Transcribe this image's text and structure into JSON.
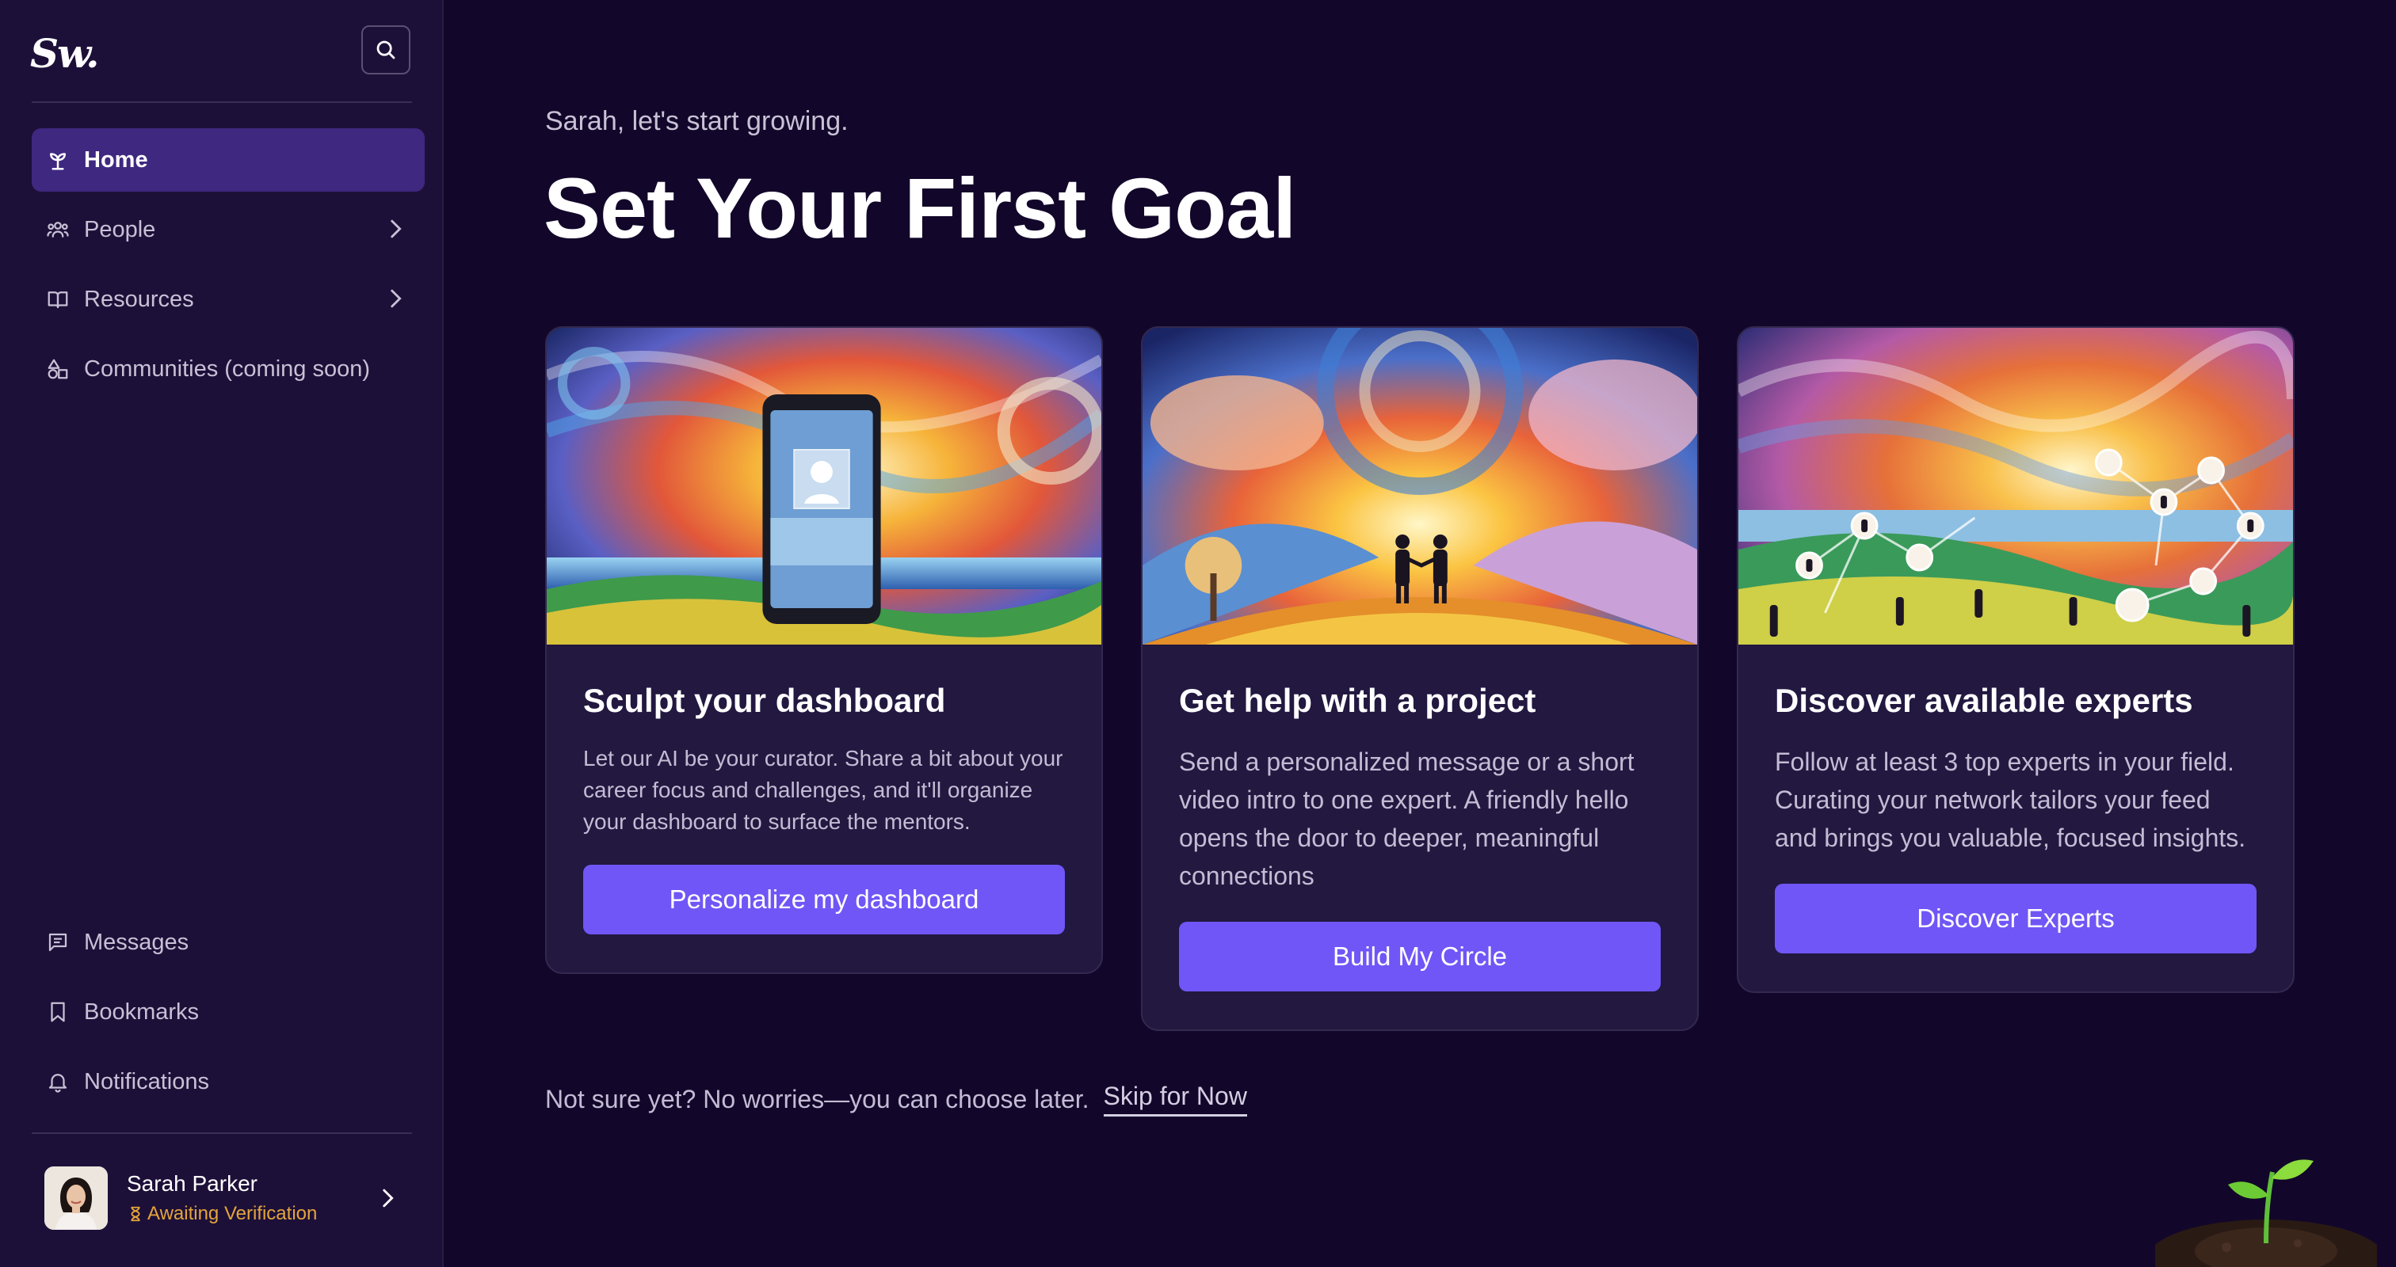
{
  "brand": {
    "logo_text": "Sw."
  },
  "sidebar": {
    "search_icon": "search-icon",
    "nav_top": [
      {
        "label": "Home",
        "icon": "sprout-icon",
        "active": true,
        "has_chevron": false
      },
      {
        "label": "People",
        "icon": "people-icon",
        "active": false,
        "has_chevron": true
      },
      {
        "label": "Resources",
        "icon": "book-icon",
        "active": false,
        "has_chevron": true
      },
      {
        "label": "Communities (coming soon)",
        "icon": "shapes-icon",
        "active": false,
        "has_chevron": false
      }
    ],
    "nav_bottom": [
      {
        "label": "Messages",
        "icon": "message-icon"
      },
      {
        "label": "Bookmarks",
        "icon": "bookmark-icon"
      },
      {
        "label": "Notifications",
        "icon": "bell-icon"
      }
    ],
    "profile": {
      "name": "Sarah Parker",
      "status": "Awaiting Verification",
      "status_color": "#e3a53c"
    }
  },
  "main": {
    "greeting": "Sarah, let's start growing.",
    "title": "Set Your First Goal",
    "cards": [
      {
        "title": "Sculpt your dashboard",
        "text": "Let our AI be your curator. Share a bit about your career focus and challenges, and it'll organize your dashboard to surface the mentors.",
        "button": "Personalize my dashboard"
      },
      {
        "title": "Get help with a project",
        "text": "Send a personalized message or a short video intro to one expert. A friendly hello opens the door to deeper, meaningful connections",
        "button": "Build My Circle"
      },
      {
        "title": "Discover available experts",
        "text": "Follow at least 3 top experts in your field. Curating your network tailors your feed and brings you valuable, focused insights.",
        "button": "Discover Experts"
      }
    ],
    "footer_note": "Not sure yet? No worries—you can choose later.",
    "skip_label": "Skip for Now"
  },
  "colors": {
    "background": "#12072a",
    "sidebar": "#1d1038",
    "active_nav": "#3f2880",
    "button": "#7056f6",
    "card": "#221840"
  }
}
